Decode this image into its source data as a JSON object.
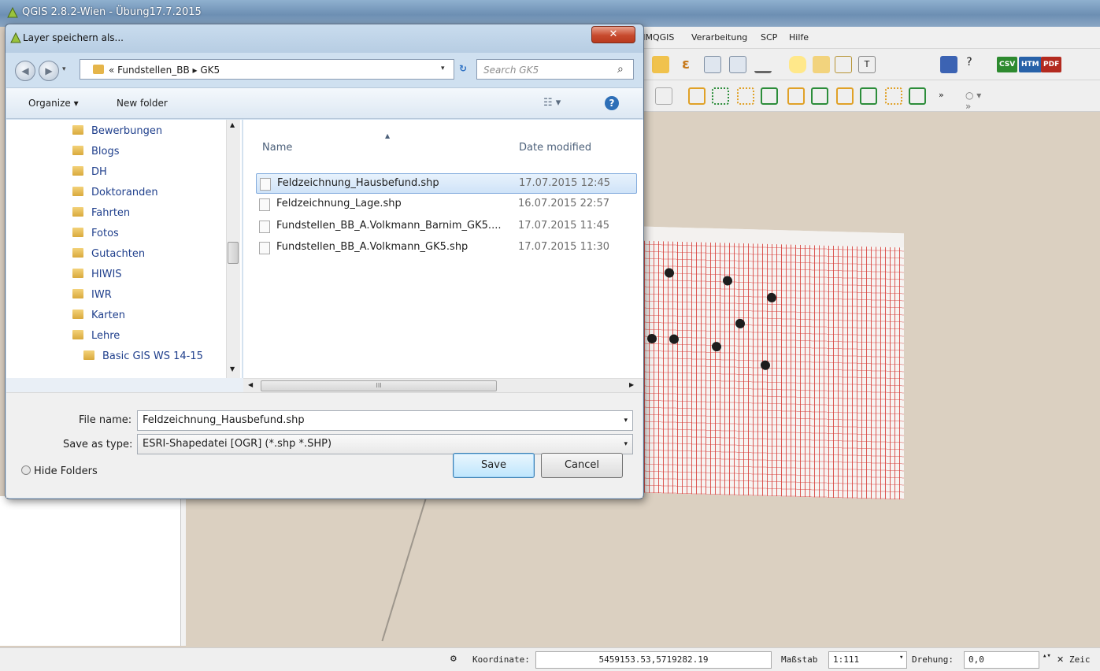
{
  "app": {
    "title": "QGIS 2.8.2-Wien - Übung17.7.2015",
    "menu": [
      "MMQGIS",
      "Verarbeitung",
      "SCP",
      "Hilfe"
    ],
    "toolbar_badges": [
      "CSV",
      "HTM",
      "PDF"
    ]
  },
  "dialog": {
    "title": "Layer speichern als...",
    "close_label": "✕",
    "address": "« Fundstellen_BB ▸ GK5",
    "search_placeholder": "Search GK5",
    "organize_label": "Organize ▾",
    "new_folder_label": "New folder",
    "nav_folders": [
      "Bewerbungen",
      "Blogs",
      "DH",
      "Doktoranden",
      "Fahrten",
      "Fotos",
      "Gutachten",
      "HIWIS",
      "IWR",
      "Karten",
      "Lehre",
      "Basic GIS WS 14-15"
    ],
    "columns": {
      "name": "Name",
      "date": "Date modified"
    },
    "files": [
      {
        "name": "Feldzeichnung_Hausbefund.shp",
        "date": "17.07.2015 12:45",
        "selected": true
      },
      {
        "name": "Feldzeichnung_Lage.shp",
        "date": "16.07.2015 22:57",
        "selected": false
      },
      {
        "name": "Fundstellen_BB_A.Volkmann_Barnim_GK5....",
        "date": "17.07.2015 11:45",
        "selected": false
      },
      {
        "name": "Fundstellen_BB_A.Volkmann_GK5.shp",
        "date": "17.07.2015 11:30",
        "selected": false
      }
    ],
    "file_name_label": "File name:",
    "file_name_value": "Feldzeichnung_Hausbefund.shp",
    "save_type_label": "Save as type:",
    "save_type_value": "ESRI-Shapedatei [OGR] (*.shp *.SHP)",
    "hide_folders_label": "Hide Folders",
    "save_label": "Save",
    "cancel_label": "Cancel",
    "hscroll_grip": "III"
  },
  "statusbar": {
    "coord_label": "Koordinate:",
    "coord_value": "5459153.53,5719282.19",
    "scale_label": "Maßstab",
    "scale_value": "1:111",
    "rotation_label": "Drehung:",
    "rotation_value": "0,0",
    "render_label": "Zeic"
  },
  "colors": {
    "accent": "#2e6fb7",
    "close": "#c74a2e",
    "map_grid": "#d63c37"
  }
}
